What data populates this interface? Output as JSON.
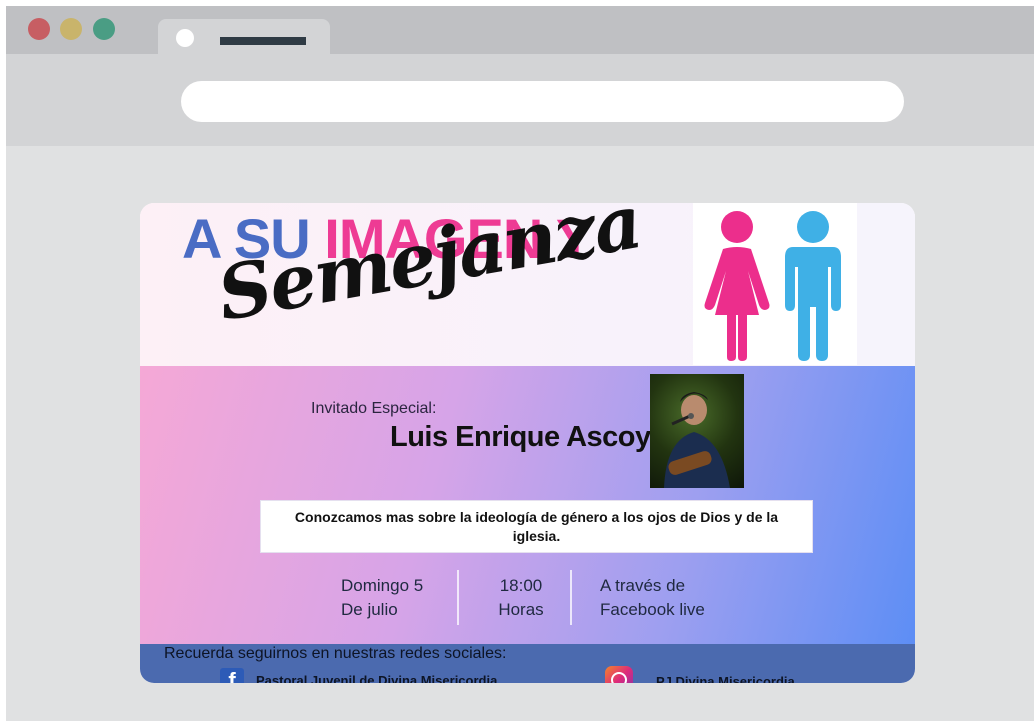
{
  "browser": {
    "url": ""
  },
  "poster": {
    "title_part1": "A SU",
    "title_part2": "IMAGEN Y",
    "title_script": "Semejanza",
    "invited_label": "Invitado Especial:",
    "guest_name": "Luis Enrique Ascoy",
    "description": "Conozcamos mas sobre la ideología de género a los ojos de Dios y de la iglesia.",
    "date_line1": "Domingo 5",
    "date_line2": "De julio",
    "time_line1": "18:00",
    "time_line2": "Horas",
    "channel_line1": "A través de",
    "channel_line2": "Facebook live",
    "follow_text": "Recuerda seguirnos en nuestras redes sociales:",
    "facebook_text": "Pastoral Juvenil de Divina Misericordia",
    "instagram_text": "PJ Divina Misericordia"
  },
  "colors": {
    "title_blue": "#4a6cc4",
    "title_pink": "#ee3b94",
    "woman_figure": "#ec2e8c",
    "man_figure": "#3fb0e6",
    "footer_band": "#4b6aaf"
  },
  "icons": [
    "woman-icon",
    "man-icon",
    "facebook-icon",
    "instagram-icon"
  ]
}
